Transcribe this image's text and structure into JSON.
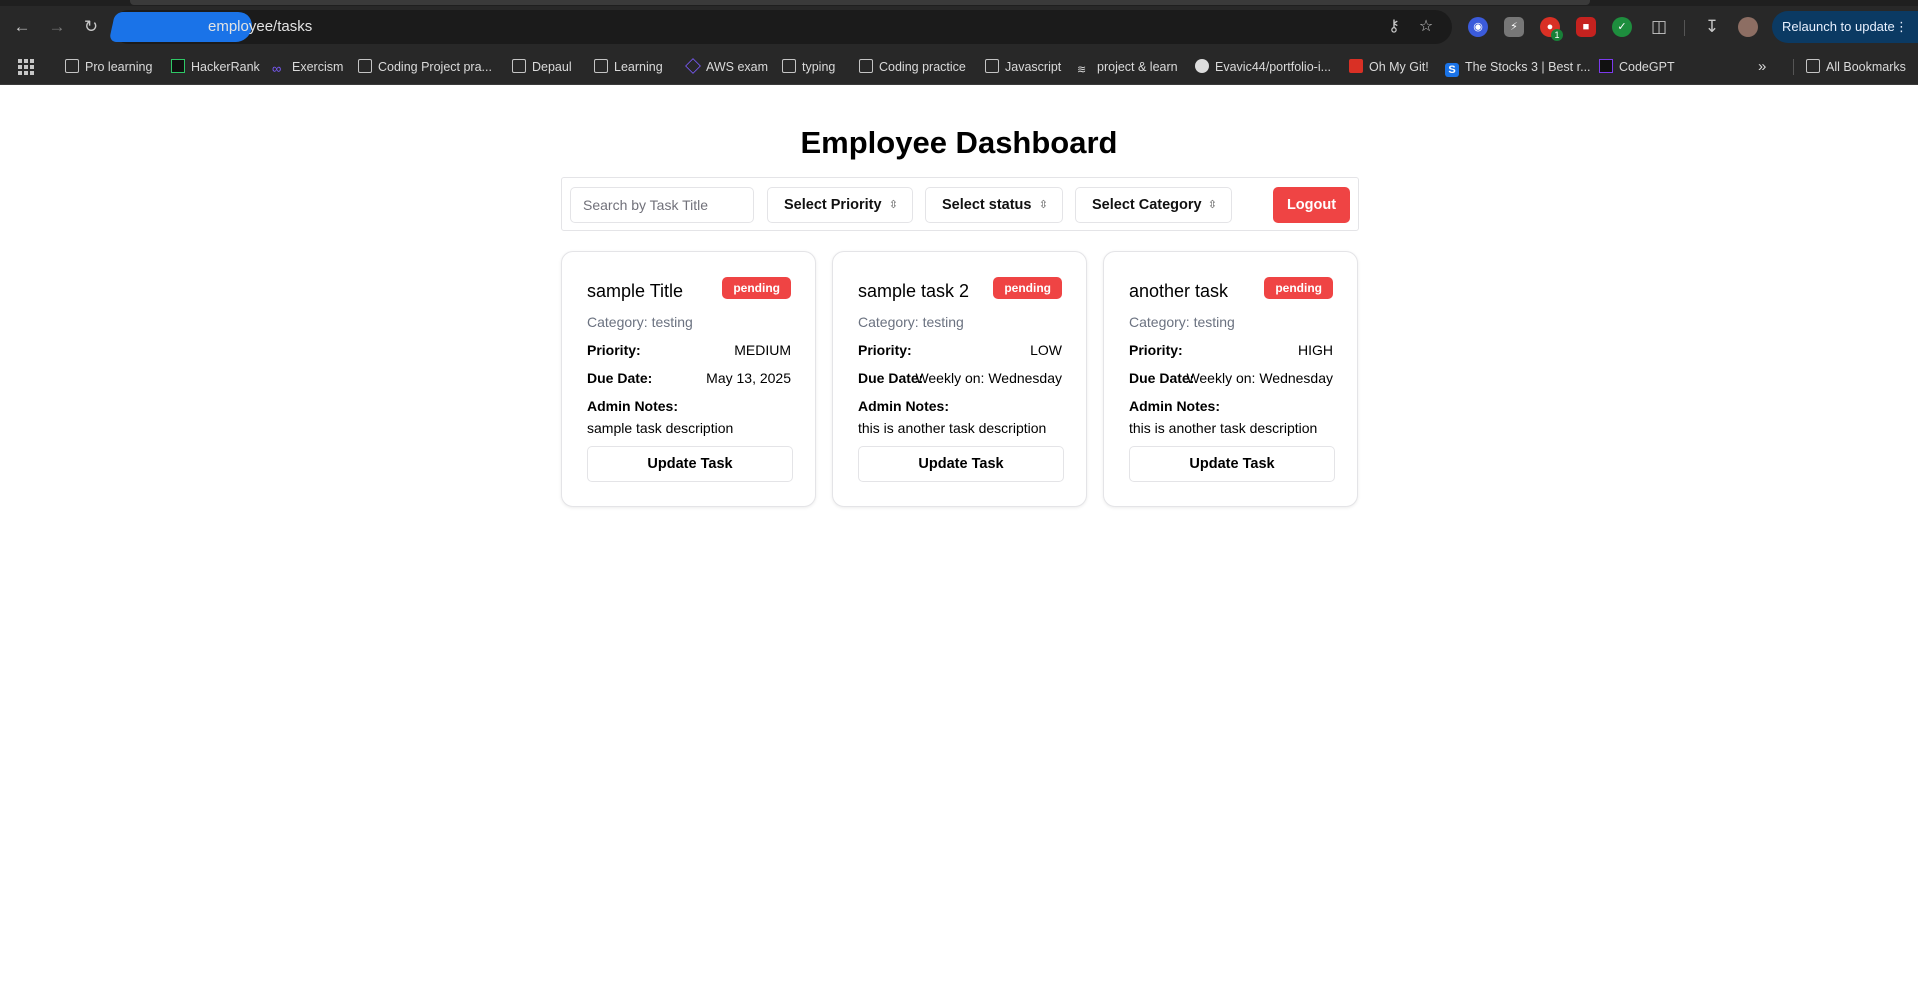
{
  "browser": {
    "url": "employee/tasks",
    "relaunch_label": "Relaunch to update",
    "bookmarks": [
      "Pro learning",
      "HackerRank",
      "Exercism",
      "Coding Project pra...",
      "Depaul",
      "Learning",
      "AWS exam",
      "typing",
      "Coding practice",
      "Javascript",
      "project & learn",
      "Evavic44/portfolio-i...",
      "Oh My Git!",
      "The Stocks 3 | Best r...",
      "CodeGPT",
      "All Bookmarks"
    ],
    "extension_badge": "1"
  },
  "page": {
    "title": "Employee Dashboard"
  },
  "filters": {
    "search_placeholder": "Search by Task Title",
    "priority_label": "Select Priority",
    "status_label": "Select status",
    "category_label": "Select Category",
    "logout_label": "Logout"
  },
  "labels": {
    "priority": "Priority:",
    "due_date": "Due Date:",
    "admin_notes": "Admin Notes:",
    "update_button": "Update Task"
  },
  "tasks": [
    {
      "title": "sample Title",
      "status": "pending",
      "category": "Category: testing",
      "priority": "MEDIUM",
      "due_date": "May 13, 2025",
      "notes": "sample task description"
    },
    {
      "title": "sample task 2",
      "status": "pending",
      "category": "Category: testing",
      "priority": "LOW",
      "due_date": "Weekly on: Wednesday",
      "notes": "this is another task description"
    },
    {
      "title": "another task",
      "status": "pending",
      "category": "Category: testing",
      "priority": "HIGH",
      "due_date": "Weekly on: Wednesday",
      "notes": "this is another task description"
    }
  ],
  "colors": {
    "accent_red": "#ef4444",
    "chrome_dark": "#282828"
  }
}
